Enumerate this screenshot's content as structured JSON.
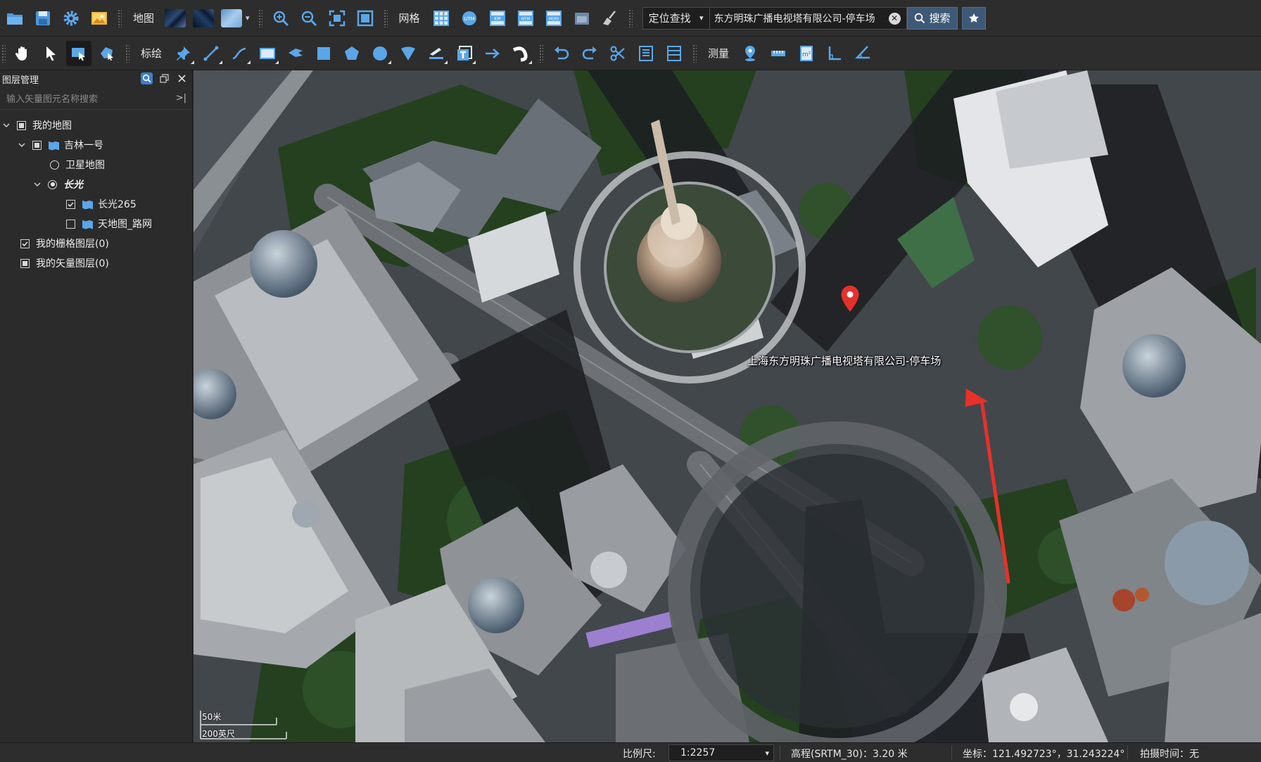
{
  "toolbar1": {
    "map_label": "地图",
    "grid_label": "网格",
    "grid_buttons": [
      "UTM",
      "KM",
      "NTM",
      "MGRS"
    ],
    "search_mode": "定位查找",
    "search_value": "东方明珠广播电视塔有限公司-停车场",
    "search_button": "搜索"
  },
  "toolbar2": {
    "annotate_label": "标绘",
    "measure_label": "测量"
  },
  "panel": {
    "title": "图层管理",
    "search_placeholder": "输入矢量图元名称搜索",
    "tree": {
      "my_map": "我的地图",
      "jilin": "吉林一号",
      "satellite": "卫星地图",
      "changguang": "长光",
      "cg265": "长光265",
      "tianditu": "天地图_路网",
      "raster": "我的栅格图层(0)",
      "vector": "我的矢量图层(0)"
    }
  },
  "map": {
    "poi_label": "上海东方明珠广播电视塔有限公司-停车场",
    "scale_metric": "50米",
    "scale_imperial": "200英尺",
    "marker_color": "#e8302a",
    "arrow_color": "#e8302a"
  },
  "status": {
    "scale_label": "比例尺:",
    "scale_value": "1:2257",
    "elevation": "高程(SRTM_30)：3.20 米",
    "coordinates": "坐标：121.492723°，31.243224°",
    "capture_time": "拍摄时间：无"
  }
}
